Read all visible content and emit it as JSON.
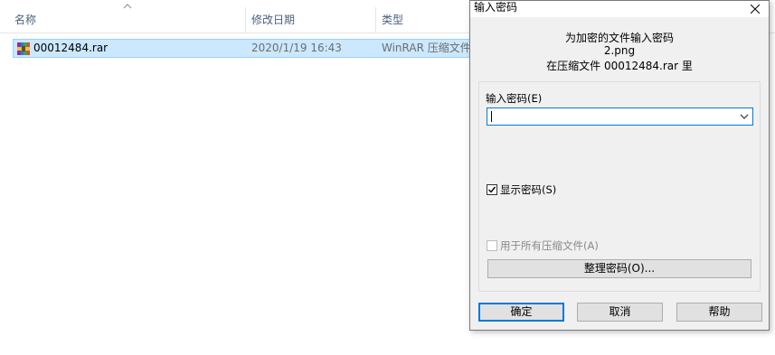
{
  "explorer": {
    "columns": {
      "name": "名称",
      "date_modified": "修改日期",
      "type": "类型"
    },
    "sort_indicator": "ascending",
    "files": [
      {
        "icon": "rar-archive-icon",
        "name": "00012484.rar",
        "date_modified": "2020/1/19 16:43",
        "type": "WinRAR 压缩文件"
      }
    ]
  },
  "dialog": {
    "title": "输入密码",
    "prompt": "为加密的文件输入密码",
    "file_name": "2.png",
    "archive_line": "在压缩文件 00012484.rar 里",
    "password_label": "输入密码(E)",
    "password_value": "",
    "show_password_label": "显示密码(S)",
    "show_password_checked": true,
    "use_for_all_label": "用于所有压缩文件(A)",
    "use_for_all_checked": false,
    "use_for_all_enabled": false,
    "organize_button": "整理密码(O)...",
    "ok_button": "确定",
    "cancel_button": "取消",
    "help_button": "帮助"
  },
  "colors": {
    "selection_bg": "#cce8ff",
    "selection_border": "#99d1ff",
    "focus_accent": "#0078d7",
    "dialog_bg": "#f0f0f0"
  }
}
